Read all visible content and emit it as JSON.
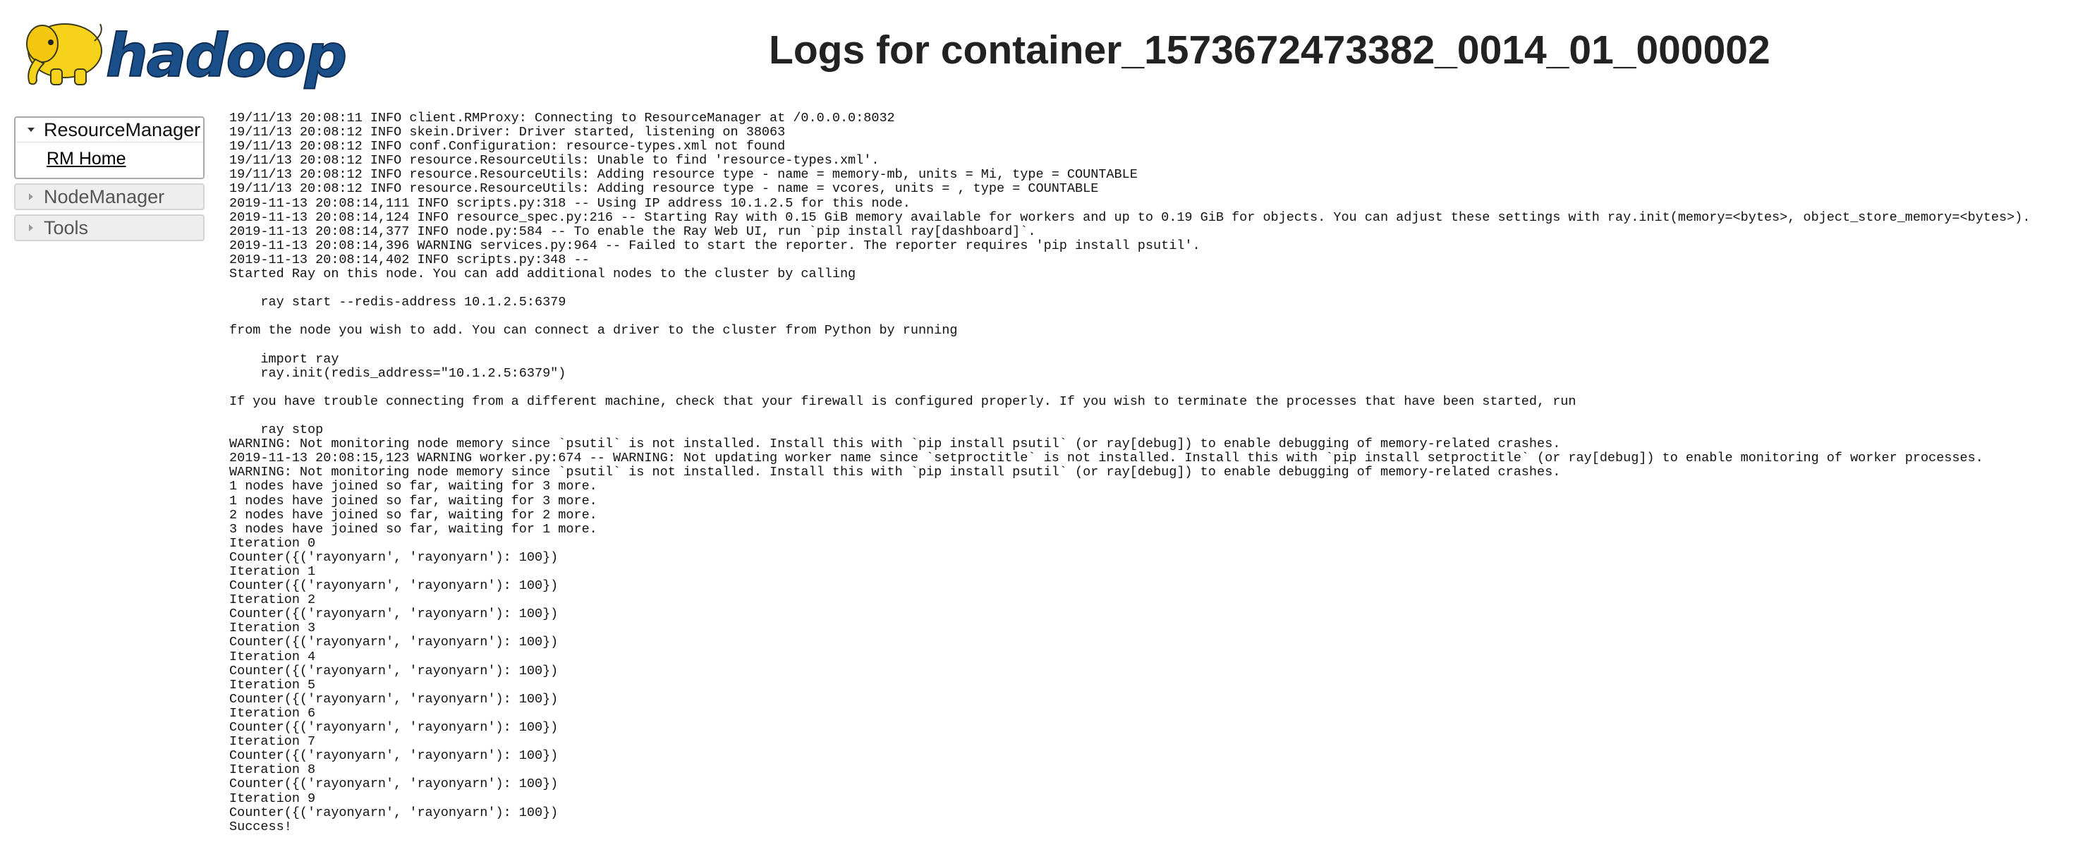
{
  "header": {
    "logo_icon": "hadoop-elephant-logo",
    "logo_text": "hadoop",
    "title": "Logs for container_1573672473382_0014_01_000002"
  },
  "nav": {
    "sections": [
      {
        "label": "ResourceManager",
        "expanded": true,
        "items": [
          {
            "label": "RM Home"
          }
        ]
      },
      {
        "label": "NodeManager",
        "expanded": false,
        "items": []
      },
      {
        "label": "Tools",
        "expanded": false,
        "items": []
      }
    ]
  },
  "log": {
    "lines": [
      "19/11/13 20:08:11 INFO client.RMProxy: Connecting to ResourceManager at /0.0.0.0:8032",
      "19/11/13 20:08:12 INFO skein.Driver: Driver started, listening on 38063",
      "19/11/13 20:08:12 INFO conf.Configuration: resource-types.xml not found",
      "19/11/13 20:08:12 INFO resource.ResourceUtils: Unable to find 'resource-types.xml'.",
      "19/11/13 20:08:12 INFO resource.ResourceUtils: Adding resource type - name = memory-mb, units = Mi, type = COUNTABLE",
      "19/11/13 20:08:12 INFO resource.ResourceUtils: Adding resource type - name = vcores, units = , type = COUNTABLE",
      "2019-11-13 20:08:14,111 INFO scripts.py:318 -- Using IP address 10.1.2.5 for this node.",
      "2019-11-13 20:08:14,124 INFO resource_spec.py:216 -- Starting Ray with 0.15 GiB memory available for workers and up to 0.19 GiB for objects. You can adjust these settings with ray.init(memory=<bytes>, object_store_memory=<bytes>).",
      "2019-11-13 20:08:14,377 INFO node.py:584 -- To enable the Ray Web UI, run `pip install ray[dashboard]`.",
      "2019-11-13 20:08:14,396 WARNING services.py:964 -- Failed to start the reporter. The reporter requires 'pip install psutil'.",
      "2019-11-13 20:08:14,402 INFO scripts.py:348 --",
      "Started Ray on this node. You can add additional nodes to the cluster by calling",
      "",
      "    ray start --redis-address 10.1.2.5:6379",
      "",
      "from the node you wish to add. You can connect a driver to the cluster from Python by running",
      "",
      "    import ray",
      "    ray.init(redis_address=\"10.1.2.5:6379\")",
      "",
      "If you have trouble connecting from a different machine, check that your firewall is configured properly. If you wish to terminate the processes that have been started, run",
      "",
      "    ray stop",
      "WARNING: Not monitoring node memory since `psutil` is not installed. Install this with `pip install psutil` (or ray[debug]) to enable debugging of memory-related crashes.",
      "2019-11-13 20:08:15,123 WARNING worker.py:674 -- WARNING: Not updating worker name since `setproctitle` is not installed. Install this with `pip install setproctitle` (or ray[debug]) to enable monitoring of worker processes.",
      "WARNING: Not monitoring node memory since `psutil` is not installed. Install this with `pip install psutil` (or ray[debug]) to enable debugging of memory-related crashes.",
      "1 nodes have joined so far, waiting for 3 more.",
      "1 nodes have joined so far, waiting for 3 more.",
      "2 nodes have joined so far, waiting for 2 more.",
      "3 nodes have joined so far, waiting for 1 more.",
      "Iteration 0",
      "Counter({('rayonyarn', 'rayonyarn'): 100})",
      "Iteration 1",
      "Counter({('rayonyarn', 'rayonyarn'): 100})",
      "Iteration 2",
      "Counter({('rayonyarn', 'rayonyarn'): 100})",
      "Iteration 3",
      "Counter({('rayonyarn', 'rayonyarn'): 100})",
      "Iteration 4",
      "Counter({('rayonyarn', 'rayonyarn'): 100})",
      "Iteration 5",
      "Counter({('rayonyarn', 'rayonyarn'): 100})",
      "Iteration 6",
      "Counter({('rayonyarn', 'rayonyarn'): 100})",
      "Iteration 7",
      "Counter({('rayonyarn', 'rayonyarn'): 100})",
      "Iteration 8",
      "Counter({('rayonyarn', 'rayonyarn'): 100})",
      "Iteration 9",
      "Counter({('rayonyarn', 'rayonyarn'): 100})",
      "Success!"
    ]
  },
  "colors": {
    "logo_yellow": "#f7d21a",
    "logo_text": "#1b4f8a",
    "title": "#222222"
  }
}
